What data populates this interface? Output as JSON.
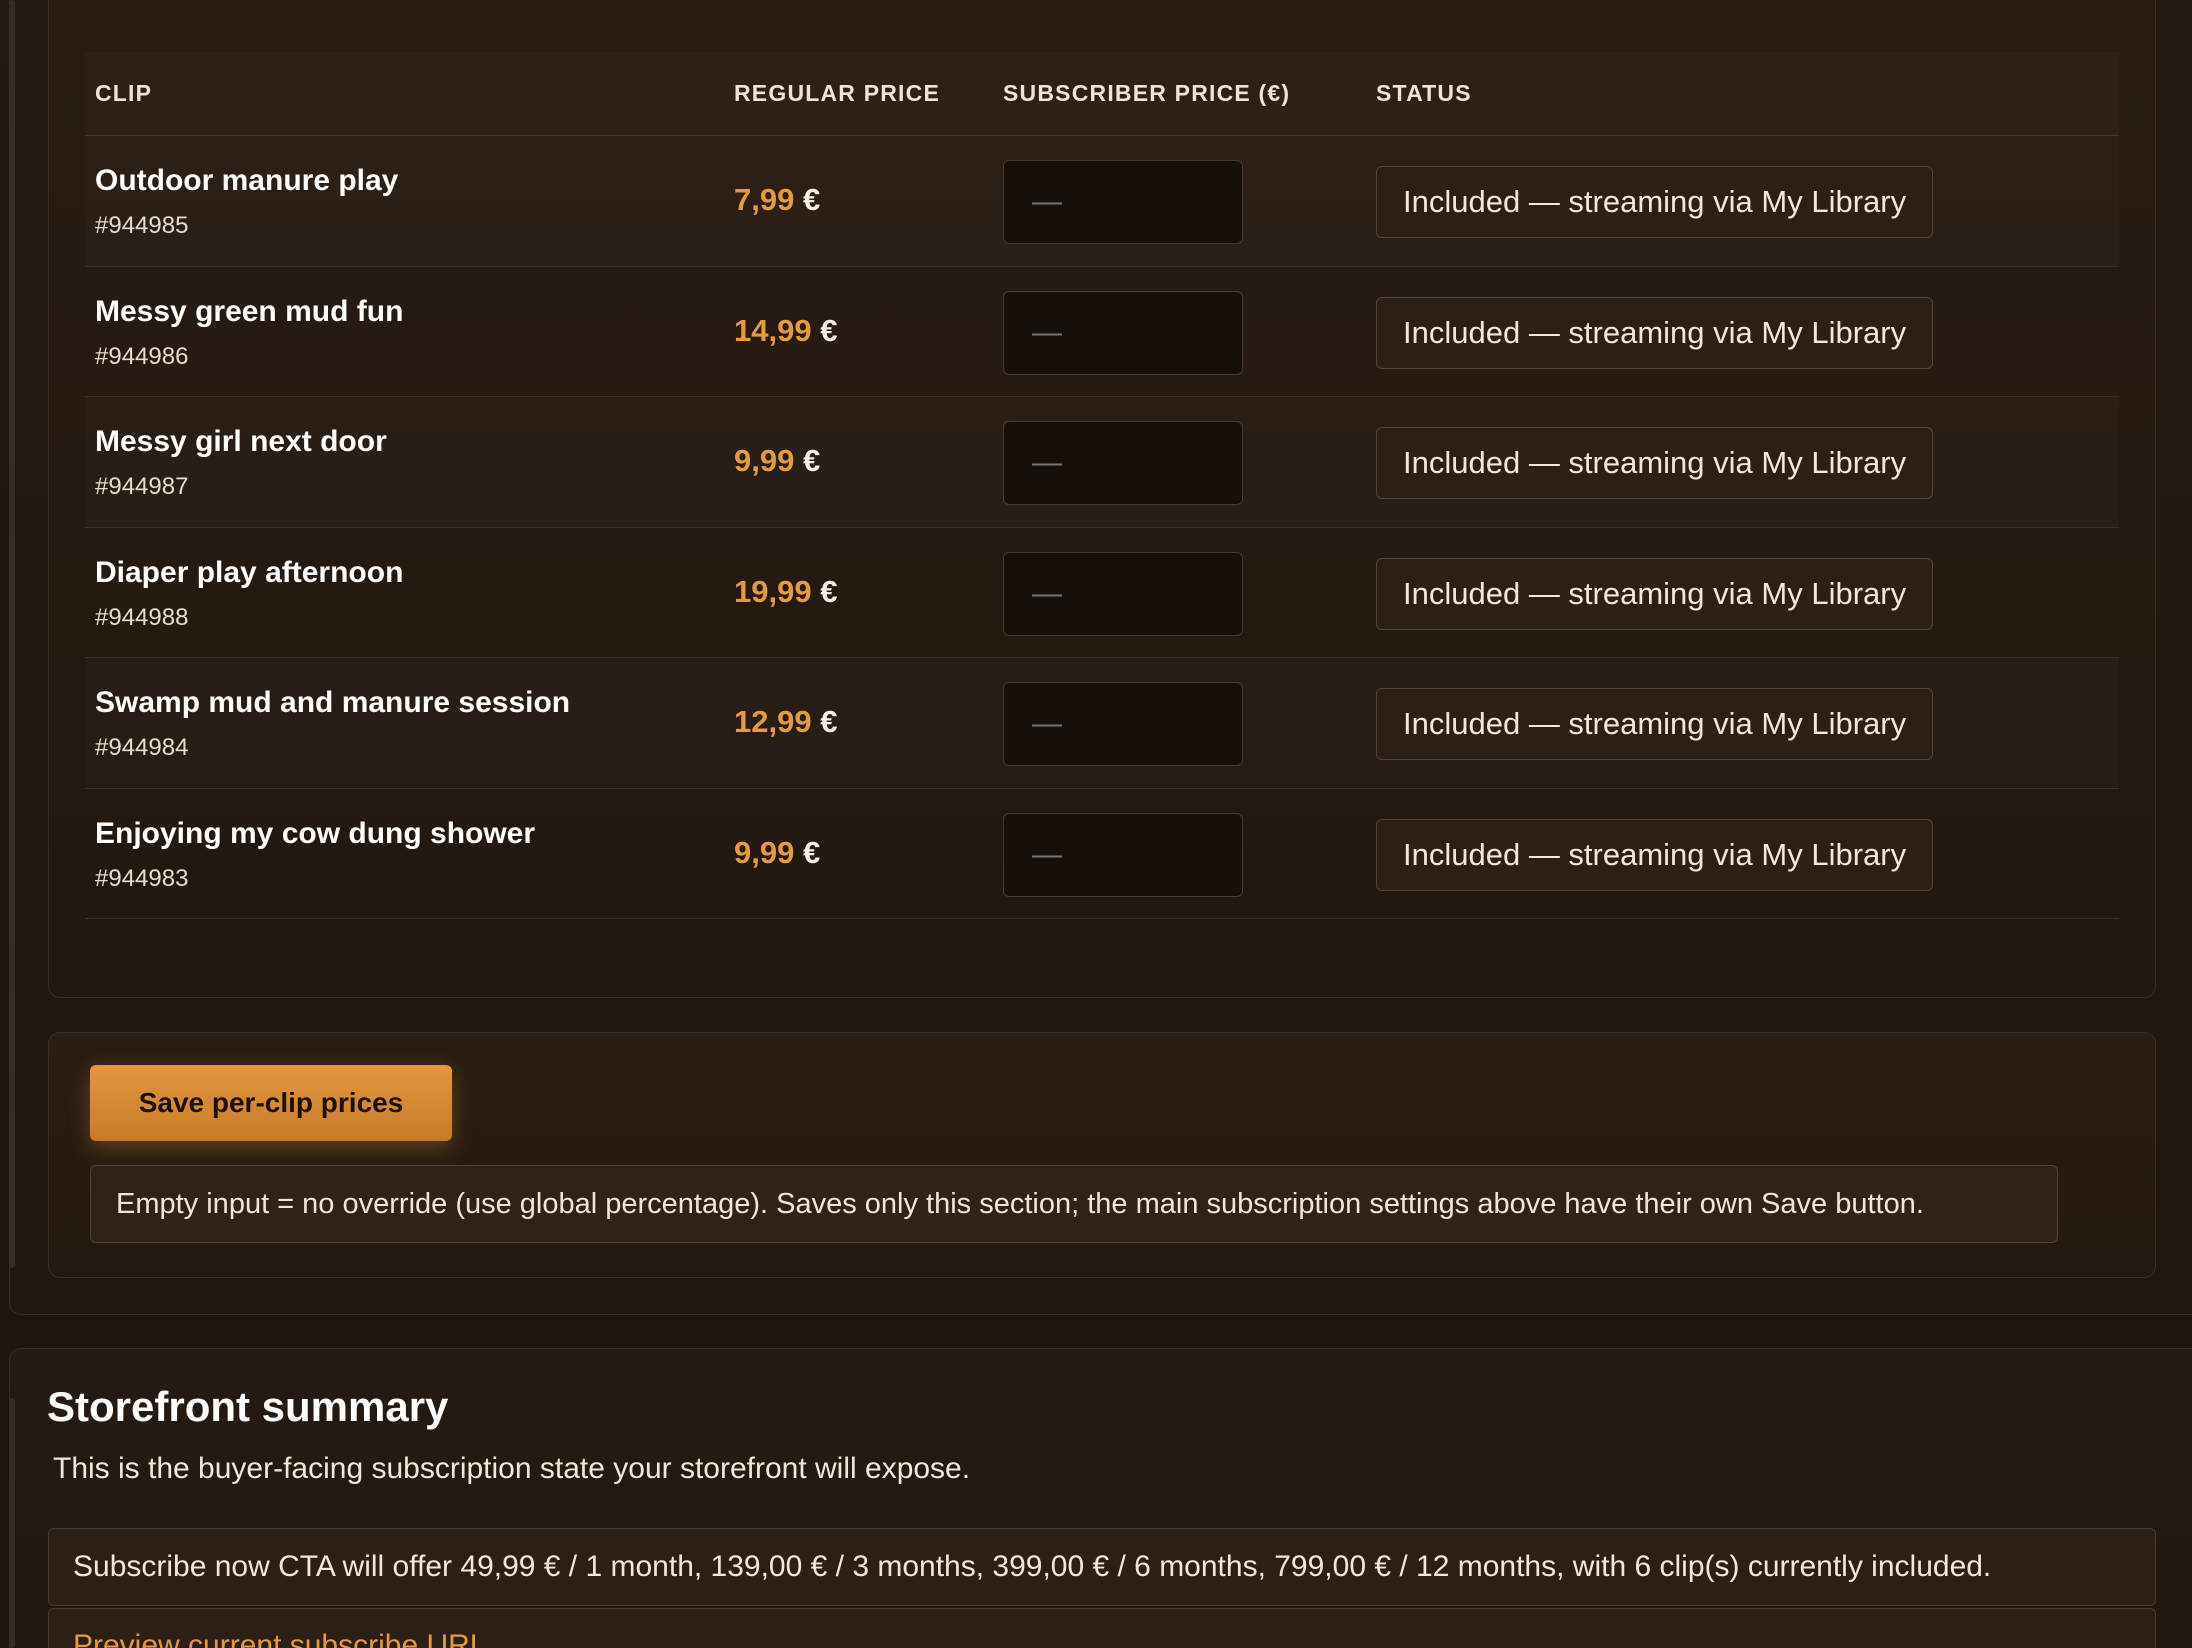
{
  "table": {
    "headers": {
      "clip": "CLIP",
      "regular_price": "REGULAR PRICE",
      "subscriber_price": "SUBSCRIBER PRICE (€)",
      "status": "STATUS"
    },
    "rows": [
      {
        "title": "Outdoor manure play",
        "id": "#944985",
        "price": "7,99",
        "currency": "€",
        "subscriber_value": "—",
        "status": "Included — streaming via My Library"
      },
      {
        "title": "Messy green mud fun",
        "id": "#944986",
        "price": "14,99",
        "currency": "€",
        "subscriber_value": "—",
        "status": "Included — streaming via My Library"
      },
      {
        "title": "Messy girl next door",
        "id": "#944987",
        "price": "9,99",
        "currency": "€",
        "subscriber_value": "—",
        "status": "Included — streaming via My Library"
      },
      {
        "title": "Diaper play afternoon",
        "id": "#944988",
        "price": "19,99",
        "currency": "€",
        "subscriber_value": "—",
        "status": "Included — streaming via My Library"
      },
      {
        "title": "Swamp mud and manure session",
        "id": "#944984",
        "price": "12,99",
        "currency": "€",
        "subscriber_value": "—",
        "status": "Included — streaming via My Library"
      },
      {
        "title": "Enjoying my cow dung shower",
        "id": "#944983",
        "price": "9,99",
        "currency": "€",
        "subscriber_value": "—",
        "status": "Included — streaming via My Library"
      }
    ]
  },
  "save_section": {
    "button_label": "Save per-clip prices",
    "note": "Empty input = no override (use global percentage). Saves only this section; the main subscription settings above have their own Save button."
  },
  "storefront": {
    "title": "Storefront summary",
    "description": "This is the buyer-facing subscription state your storefront will expose.",
    "summary": "Subscribe now CTA will offer 49,99 € / 1 month, 139,00 € / 3 months, 399,00 € / 6 months, 799,00 € / 12 months, with 6 clip(s) currently included.",
    "preview_link": "Preview current subscribe URL"
  },
  "colors": {
    "accent": "#e59a3f",
    "background": "#1c140e",
    "button": "#d8882f"
  }
}
